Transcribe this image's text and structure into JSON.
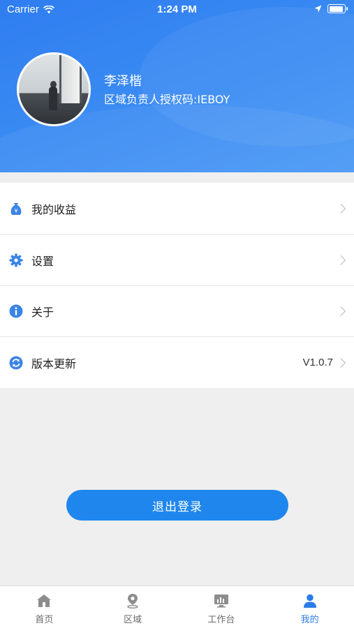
{
  "status_bar": {
    "carrier": "Carrier",
    "time": "1:24 PM",
    "battery_level": 0.95
  },
  "profile": {
    "name": "李泽楷",
    "auth_code": "区域负责人授权码:IEBOY"
  },
  "menu": {
    "items": [
      {
        "label": "我的收益",
        "icon": "money-bag-icon",
        "value": ""
      },
      {
        "label": "设置",
        "icon": "gear-icon",
        "value": ""
      },
      {
        "label": "关于",
        "icon": "info-icon",
        "value": ""
      },
      {
        "label": "版本更新",
        "icon": "refresh-icon",
        "value": "V1.0.7"
      }
    ]
  },
  "logout_label": "退出登录",
  "tabbar": {
    "tabs": [
      {
        "label": "首页",
        "icon": "home-icon"
      },
      {
        "label": "区域",
        "icon": "location-pin-icon"
      },
      {
        "label": "工作台",
        "icon": "dashboard-icon"
      },
      {
        "label": "我的",
        "icon": "person-icon"
      }
    ],
    "active_index": 3
  },
  "colors": {
    "header_blue": "#3b8cf3",
    "accent": "#1f86ed",
    "active_tab": "#2b7ce8",
    "background": "#efefef"
  }
}
